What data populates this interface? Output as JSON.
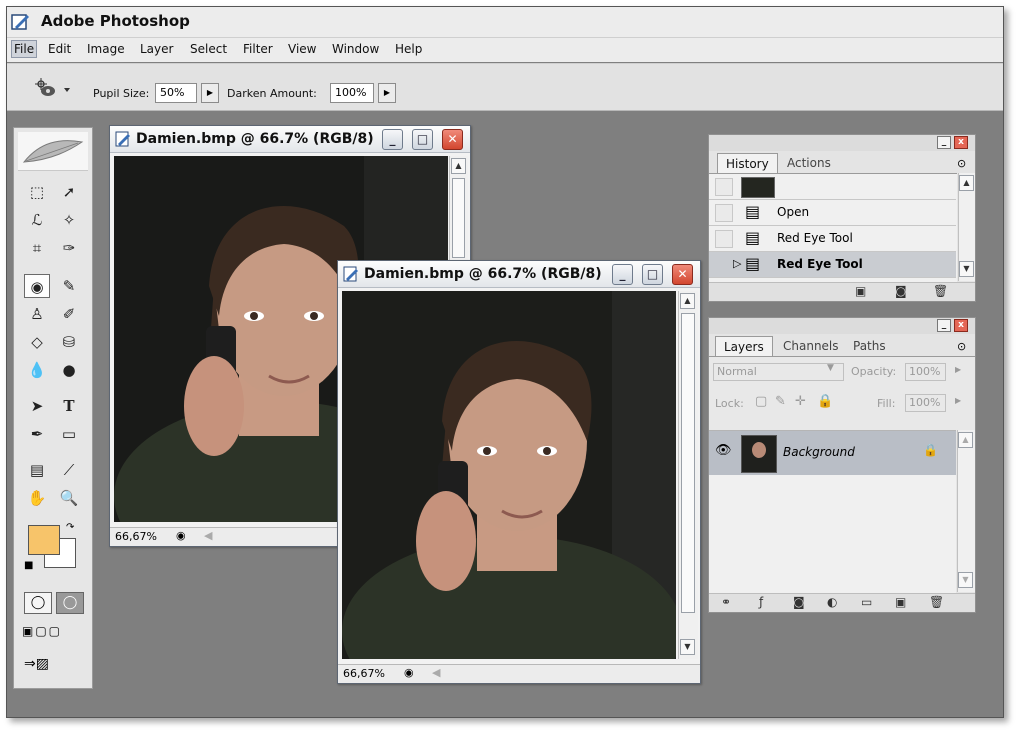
{
  "app": {
    "title": "Adobe Photoshop"
  },
  "menu": [
    "File",
    "Edit",
    "Image",
    "Layer",
    "Select",
    "Filter",
    "View",
    "Window",
    "Help"
  ],
  "options": {
    "pupil_label": "Pupil Size:",
    "pupil_value": "50%",
    "darken_label": "Darken Amount:",
    "darken_value": "100%"
  },
  "doc_back": {
    "title": "Damien.bmp @ 66.7% (RGB/8)",
    "zoom": "66,67%"
  },
  "doc_front": {
    "title": "Damien.bmp @ 66.7% (RGB/8)",
    "zoom": "66,67%"
  },
  "history": {
    "tabs": [
      "History",
      "Actions"
    ],
    "items": [
      "Open",
      "Red Eye Tool",
      "Red Eye Tool"
    ]
  },
  "layers": {
    "tabs": [
      "Layers",
      "Channels",
      "Paths"
    ],
    "blend_mode": "Normal",
    "opacity_label": "Opacity:",
    "opacity_value": "100%",
    "lock_label": "Lock:",
    "fill_label": "Fill:",
    "fill_value": "100%",
    "layer_name": "Background"
  },
  "colors": {
    "foreground": "#f7c46a",
    "background": "#ffffff",
    "workspace": "#7f7f7f"
  }
}
